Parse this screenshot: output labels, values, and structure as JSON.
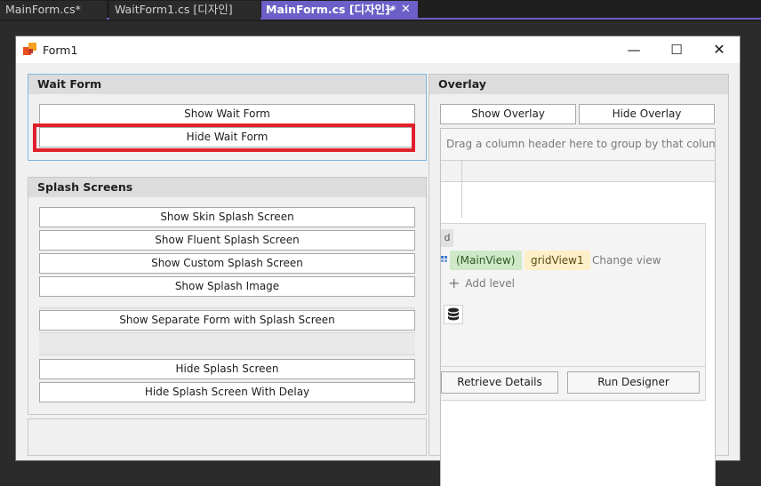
{
  "ide": {
    "tabs": [
      {
        "label": "MainForm.cs*"
      },
      {
        "label": "WaitForm1.cs [디자인]"
      },
      {
        "label": "MainForm.cs [디자인]*"
      }
    ],
    "pin_glyph": "⊸",
    "close_glyph": "✕"
  },
  "form": {
    "title": "Form1",
    "controls": {
      "minimize": "—",
      "maximize": "☐",
      "close": "✕"
    }
  },
  "wait_form": {
    "caption": "Wait Form",
    "show_label": "Show Wait Form",
    "hide_label": "Hide Wait Form"
  },
  "splash": {
    "caption": "Splash Screens",
    "buttons": [
      "Show Skin Splash Screen",
      "Show Fluent Splash Screen",
      "Show Custom Splash Screen",
      "Show Splash Image",
      "Show Separate Form with Splash Screen",
      "Hide Splash Screen",
      "Hide Splash Screen With Delay"
    ]
  },
  "overlay": {
    "caption": "Overlay",
    "show_label": "Show Overlay",
    "hide_label": "Hide Overlay",
    "grid": {
      "group_panel_text": "Drag a column header here to group by that column",
      "level_tab": "d",
      "main_view_chip": "(MainView)",
      "grid_view_chip": "gridView1",
      "change_view": "Change view",
      "add_level": "Add level",
      "retrieve_details": "Retrieve Details",
      "run_designer": "Run Designer"
    }
  },
  "colors": {
    "accent_tab": "#6c5fc7",
    "highlight": "#e0202a",
    "main_view_chip": "#cfe8c8",
    "grid_view_chip": "#fdf0c8"
  }
}
